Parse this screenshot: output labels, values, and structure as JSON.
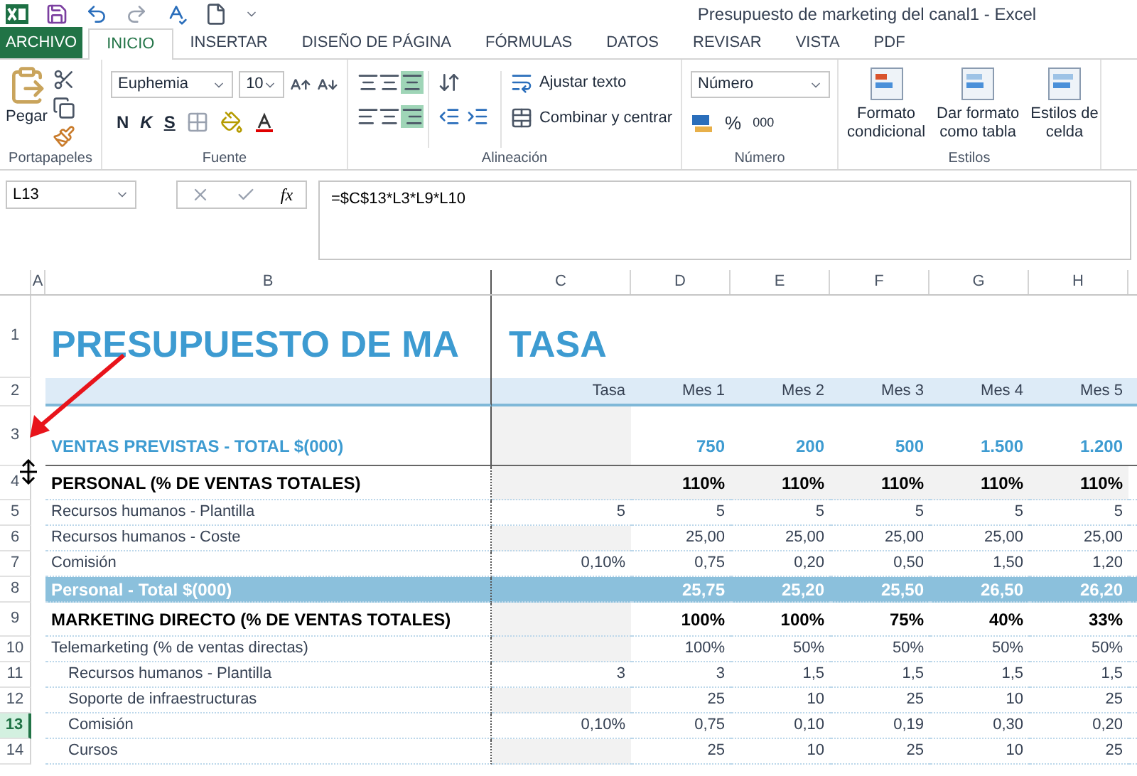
{
  "window": {
    "title": "Presupuesto de marketing del canal1 - Excel"
  },
  "tabs": [
    {
      "label": "ARCHIVO",
      "kind": "file",
      "selected": false
    },
    {
      "label": "INICIO",
      "kind": "tab",
      "selected": true
    },
    {
      "label": "INSERTAR",
      "kind": "tab",
      "selected": false
    },
    {
      "label": "DISEÑO DE PÁGINA",
      "kind": "tab",
      "selected": false
    },
    {
      "label": "FÓRMULAS",
      "kind": "tab",
      "selected": false
    },
    {
      "label": "DATOS",
      "kind": "tab",
      "selected": false
    },
    {
      "label": "REVISAR",
      "kind": "tab",
      "selected": false
    },
    {
      "label": "VISTA",
      "kind": "tab",
      "selected": false
    },
    {
      "label": "PDF",
      "kind": "tab",
      "selected": false
    }
  ],
  "ribbon": {
    "paste": "Pegar",
    "font": "Euphemia",
    "font_size": "10",
    "bold": "N",
    "italic": "K",
    "underline": "S",
    "wrap_text": "Ajustar texto",
    "merge": "Combinar y centrar",
    "number_format": "Número",
    "percent": "%",
    "thousands": "000",
    "conditional": [
      "Formato",
      "condicional"
    ],
    "as_table": [
      "Dar formato",
      "como tabla"
    ],
    "cell_styles": [
      "Estilos de",
      "celda"
    ],
    "groups": [
      "Portapapeles",
      "Fuente",
      "Alineación",
      "Número",
      "Estilos"
    ]
  },
  "formula_bar": {
    "name_box": "L13",
    "fx": "fx",
    "formula": "=$C$13*L3*L9*L10"
  },
  "columns": [
    "A",
    "B",
    "C",
    "D",
    "E",
    "F",
    "G",
    "H"
  ],
  "rows": [
    {
      "number": "1",
      "kind": "title",
      "selected": false,
      "label": "PRESUPUESTO DE MA",
      "rate": "TASA",
      "values": []
    },
    {
      "number": "2",
      "kind": "header",
      "selected": false,
      "rate": "Tasa",
      "values": [
        "Mes 1",
        "Mes 2",
        "Mes 3",
        "Mes 4",
        "Mes 5"
      ]
    },
    {
      "number": "3",
      "kind": "total_sales",
      "selected": false,
      "label": "VENTAS PREVISTAS - TOTAL $(000)",
      "values": [
        "750",
        "200",
        "500",
        "1.500",
        "1.200"
      ]
    },
    {
      "number": "4",
      "kind": "section",
      "selected": false,
      "label": "PERSONAL (% DE VENTAS TOTALES)",
      "values": [
        "110%",
        "110%",
        "110%",
        "110%",
        "110%"
      ]
    },
    {
      "number": "5",
      "kind": "item",
      "selected": false,
      "label": "Recursos humanos - Plantilla",
      "rate": "5",
      "values": [
        "5",
        "5",
        "5",
        "5",
        "5"
      ]
    },
    {
      "number": "6",
      "kind": "item",
      "selected": false,
      "label": "Recursos humanos - Coste",
      "values": [
        "25,00",
        "25,00",
        "25,00",
        "25,00",
        "25,00"
      ]
    },
    {
      "number": "7",
      "kind": "item",
      "selected": false,
      "label": "Comisión",
      "rate": "0,10%",
      "values": [
        "0,75",
        "0,20",
        "0,50",
        "1,50",
        "1,20"
      ]
    },
    {
      "number": "8",
      "kind": "subtotal",
      "selected": false,
      "label": "Personal - Total $(000)",
      "values": [
        "25,75",
        "25,20",
        "25,50",
        "26,50",
        "26,20"
      ]
    },
    {
      "number": "9",
      "kind": "section",
      "selected": false,
      "label": "MARKETING DIRECTO (% DE VENTAS TOTALES)",
      "values": [
        "100%",
        "100%",
        "75%",
        "40%",
        "33%"
      ]
    },
    {
      "number": "10",
      "kind": "item",
      "selected": false,
      "label": "Telemarketing (% de ventas directas)",
      "values": [
        "100%",
        "50%",
        "50%",
        "50%",
        "50%"
      ]
    },
    {
      "number": "11",
      "kind": "subitem",
      "selected": false,
      "label": "Recursos humanos - Plantilla",
      "rate": "3",
      "values": [
        "3",
        "1,5",
        "1,5",
        "1,5",
        "1,5"
      ]
    },
    {
      "number": "12",
      "kind": "subitem",
      "selected": false,
      "label": "Soporte de infraestructuras",
      "values": [
        "25",
        "10",
        "25",
        "10",
        "25"
      ]
    },
    {
      "number": "13",
      "kind": "subitem",
      "selected": true,
      "label": "Comisión",
      "rate": "0,10%",
      "values": [
        "0,75",
        "0,10",
        "0,19",
        "0,30",
        "0,20"
      ]
    },
    {
      "number": "14",
      "kind": "subitem",
      "selected": false,
      "label": "Cursos",
      "values": [
        "25",
        "10",
        "25",
        "10",
        "25"
      ]
    }
  ]
}
